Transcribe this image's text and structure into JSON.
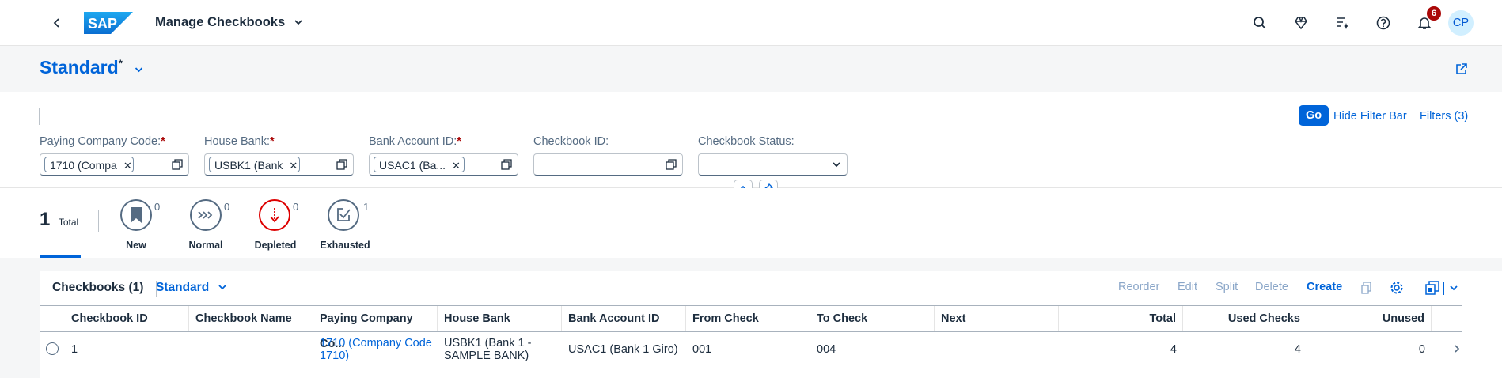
{
  "shell": {
    "logo": "SAP",
    "app_title": "Manage Checkbooks",
    "notification_count": "6",
    "avatar_initials": "CP"
  },
  "header": {
    "variant": "Standard",
    "modified_marker": "*"
  },
  "filters": {
    "go": "Go",
    "hide_filter_bar": "Hide Filter Bar",
    "filters_count": "Filters (3)",
    "fields": [
      {
        "label": "Paying Company Code:",
        "required": "*",
        "token": "1710 (Compa"
      },
      {
        "label": "House Bank:",
        "required": "*",
        "token": "USBK1 (Bank"
      },
      {
        "label": "Bank Account ID:",
        "required": "*",
        "token": "USAC1 (Ba..."
      },
      {
        "label": "Checkbook ID:",
        "required": "",
        "token": ""
      },
      {
        "label": "Checkbook Status:",
        "required": "",
        "token": ""
      }
    ]
  },
  "kpis": {
    "total_value": "1",
    "total_label": "Total",
    "items": [
      {
        "label": "New",
        "count": "0"
      },
      {
        "label": "Normal",
        "count": "0"
      },
      {
        "label": "Depleted",
        "count": "0"
      },
      {
        "label": "Exhausted",
        "count": "1"
      }
    ]
  },
  "table": {
    "title": "Checkbooks (1)",
    "variant": "Standard",
    "actions": [
      "Reorder",
      "Edit",
      "Split",
      "Delete",
      "Create"
    ],
    "columns": [
      "Checkbook ID",
      "Checkbook Name",
      "Paying Company Co...",
      "House Bank",
      "Bank Account ID",
      "From Check",
      "To Check",
      "Next",
      "Total",
      "Used Checks",
      "Unused"
    ],
    "rows": [
      {
        "checkbook_id": "1",
        "checkbook_name": "",
        "company_line1": "1710 (Company Code",
        "company_line2": "1710)",
        "house_bank_line1": "USBK1 (Bank 1 -",
        "house_bank_line2": "SAMPLE BANK)",
        "bank_account": "USAC1 (Bank 1 Giro)",
        "from_check": "001",
        "to_check": "004",
        "next": "",
        "total": "4",
        "used": "4",
        "unused": "0"
      }
    ]
  },
  "colors": {
    "brand_blue": "#0064d9",
    "danger": "#d00",
    "badge": "#aa0808"
  }
}
